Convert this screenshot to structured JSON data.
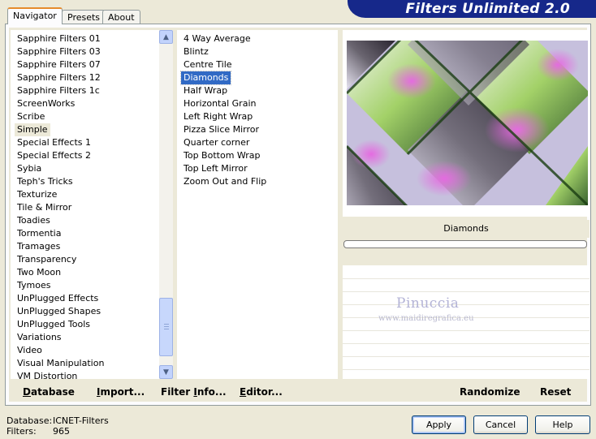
{
  "header": {
    "title": "Filters Unlimited 2.0"
  },
  "tabs": [
    {
      "label": "Navigator",
      "active": true
    },
    {
      "label": "Presets"
    },
    {
      "label": "About"
    }
  ],
  "categories": {
    "items": [
      "Sapphire Filters 01",
      "Sapphire Filters 03",
      "Sapphire Filters 07",
      "Sapphire Filters 12",
      "Sapphire Filters 1c",
      "ScreenWorks",
      "Scribe",
      "Simple",
      "Special Effects 1",
      "Special Effects 2",
      "Sybia",
      "Teph's Tricks",
      "Texturize",
      "Tile & Mirror",
      "Toadies",
      "Tormentia",
      "Tramages",
      "Transparency",
      "Two Moon",
      "Tymoes",
      "UnPlugged Effects",
      "UnPlugged Shapes",
      "UnPlugged Tools",
      "Variations",
      "Video",
      "Visual Manipulation",
      "VM Distortion"
    ],
    "highlighted": "Simple"
  },
  "filters": {
    "items": [
      "4 Way Average",
      "Blintz",
      "Centre Tile",
      "Diamonds",
      "Half Wrap",
      "Horizontal Grain",
      "Left Right Wrap",
      "Pizza Slice Mirror",
      "Quarter corner",
      "Top Bottom Wrap",
      "Top Left Mirror",
      "Zoom Out and Flip"
    ],
    "selected": "Diamonds"
  },
  "preview": {
    "filter_name": "Diamonds",
    "watermark_name": "Pinuccia",
    "watermark_url": "www.maidiregrafica.eu"
  },
  "toolbar": {
    "database_first": "D",
    "database_rest": "atabase",
    "import_first": "I",
    "import_rest": "mport...",
    "filterinfo_prefix": "Filter ",
    "filterinfo_mid": "I",
    "filterinfo_rest": "nfo...",
    "editor_first": "E",
    "editor_rest": "ditor...",
    "randomize": "Randomize",
    "reset": "Reset"
  },
  "status": {
    "database_label": "Database:",
    "database_value": "ICNET-Filters",
    "filters_label": "Filters:",
    "filters_value": "965"
  },
  "buttons": {
    "apply": "Apply",
    "cancel": "Cancel",
    "help": "Help"
  },
  "colors": {
    "banner": "#16288a",
    "selection": "#316ac5",
    "face": "#ece9d8"
  }
}
